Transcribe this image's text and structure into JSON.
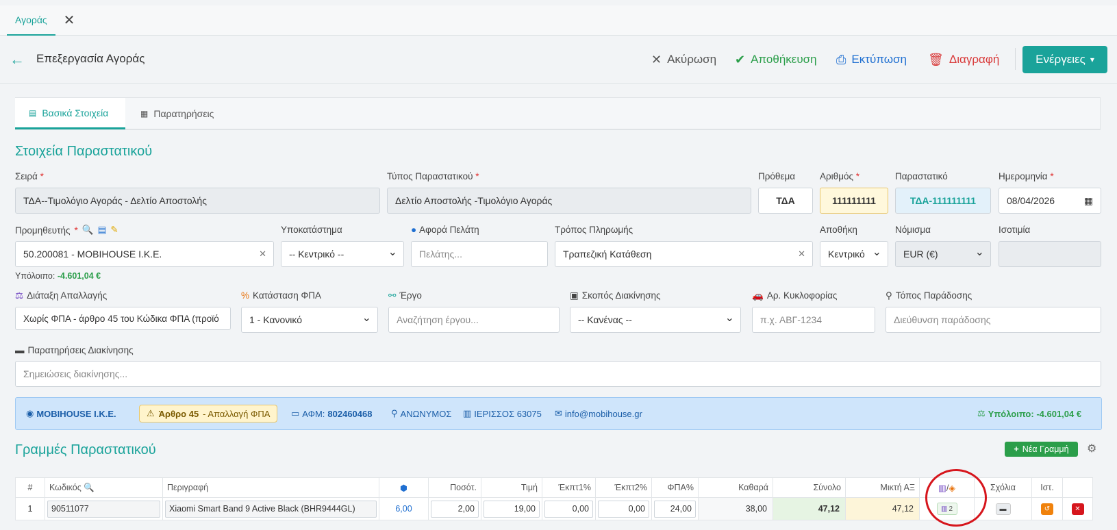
{
  "tabs": {
    "active": "Αγοράς",
    "close": "✕"
  },
  "header": {
    "title": "Επεξεργασία Αγοράς",
    "cancel": "Ακύρωση",
    "save": "Αποθήκευση",
    "print": "Εκτύπωση",
    "delete": "Διαγραφή",
    "actions": "Ενέργειες"
  },
  "card_tabs": {
    "basic": "Βασικά Στοιχεία",
    "notes": "Παρατηρήσεις"
  },
  "section_title": "Στοιχεία Παραστατικού",
  "form": {
    "series_label": "Σειρά",
    "series_value": "ΤΔΑ--Τιμολόγιο Αγοράς - Δελτίο Αποστολής",
    "doctype_label": "Τύπος Παραστατικού",
    "doctype_value": "Δελτίο Αποστολής -Τιμολόγιο Αγοράς",
    "prefix_label": "Πρόθεμα",
    "prefix_value": "ΤΔΑ",
    "number_label": "Αριθμός",
    "number_value": "111111111",
    "doc_label": "Παραστατικό",
    "doc_value": "ΤΔΑ-111111111",
    "date_label": "Ημερομηνία",
    "date_value": "08/04/2026",
    "supplier_label": "Προμηθευτής",
    "supplier_value": "50.200081 - MOBIHOUSE I.K.E.",
    "branch_label": "Υποκατάστημα",
    "branch_value": "-- Κεντρικό --",
    "customer_label": "Αφορά Πελάτη",
    "customer_placeholder": "Πελάτης...",
    "payment_label": "Τρόπος Πληρωμής",
    "payment_value": "Τραπεζική Κατάθεση",
    "warehouse_label": "Αποθήκη",
    "warehouse_value": "Κεντρικό",
    "currency_label": "Νόμισμα",
    "currency_value": "EUR (€)",
    "rate_label": "Ισοτιμία",
    "balance_label": "Υπόλοιπο:",
    "balance_value": "-4.601,04 €",
    "exemption_label": "Διάταξη Απαλλαγής",
    "exemption_value": "Χωρίς ΦΠΑ - άρθρο 45 του Κώδικα ΦΠΑ (προϊό",
    "vat_status_label": "Κατάσταση ΦΠΑ",
    "vat_status_value": "1 - Κανονικό",
    "project_label": "Έργο",
    "project_placeholder": "Αναζήτηση έργου...",
    "purpose_label": "Σκοπός Διακίνησης",
    "purpose_value": "-- Κανένας --",
    "plate_label": "Αρ. Κυκλοφορίας",
    "plate_placeholder": "π.χ. ΑΒΓ-1234",
    "delivery_label": "Τόπος Παράδοσης",
    "delivery_placeholder": "Διεύθυνση παράδοσης",
    "movenotes_label": "Παρατηρήσεις Διακίνησης",
    "movenotes_placeholder": "Σημειώσεις διακίνησης..."
  },
  "infobar": {
    "name": "MOBIHOUSE I.K.E.",
    "badge_bold": "Άρθρο 45",
    "badge_rest": "- Απαλλαγή ΦΠΑ",
    "afm_label": "ΑΦΜ:",
    "afm_value": "802460468",
    "city": "ΑΝΩΝΥΜΟΣ",
    "area": "ΙΕΡΙΣΣΟΣ 63075",
    "email": "info@mobihouse.gr",
    "balance": "Υπόλοιπο: -4.601,04 €"
  },
  "lines": {
    "title": "Γραμμές Παραστατικού",
    "new_line": "Νέα Γραμμή",
    "columns": [
      "#",
      "Κωδικός",
      "Περιγραφή",
      "",
      "Ποσότ.",
      "Τιμή",
      "Έκπτ1%",
      "Έκπτ2%",
      "ΦΠΑ%",
      "Καθαρά",
      "Σύνολο",
      "Μικτή ΑΞ",
      "/",
      "Σχόλια",
      "Ιστ.",
      ""
    ],
    "rows": [
      {
        "n": "1",
        "code": "90511077",
        "desc": "Xiaomi Smart Band 9 Active Black (BHR9444GL)",
        "stock": "6,00",
        "qty": "2,00",
        "price": "19,00",
        "d1": "0,00",
        "d2": "0,00",
        "vat": "24,00",
        "net": "38,00",
        "total": "47,12",
        "gross": "47,12",
        "serials": "2"
      }
    ]
  },
  "colors": {
    "accent": "#1aa39a",
    "save": "#2b9e4a",
    "print": "#1f6fd1",
    "delete": "#d93a3a"
  }
}
